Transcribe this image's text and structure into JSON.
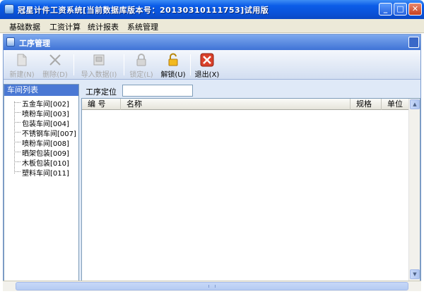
{
  "window": {
    "title": "冠星计件工资系统[当前数据库版本号：20130310111753]试用版",
    "minimize_glyph": "_",
    "maximize_glyph": "□",
    "close_glyph": "✕"
  },
  "menubar": {
    "items": [
      {
        "label": "基础数据"
      },
      {
        "label": "工资计算"
      },
      {
        "label": "统计报表"
      },
      {
        "label": "系统管理"
      }
    ]
  },
  "panel": {
    "title": "工序管理"
  },
  "toolbar": {
    "buttons": [
      {
        "label": "新建(N)",
        "icon": "new-document-icon",
        "enabled": false
      },
      {
        "label": "删除(D)",
        "icon": "delete-x-icon",
        "enabled": false
      },
      {
        "label": "导入数据(I)",
        "icon": "import-data-icon",
        "enabled": false
      },
      {
        "label": "锁定(L)",
        "icon": "lock-icon",
        "enabled": false
      },
      {
        "label": "解锁(U)",
        "icon": "unlock-icon",
        "enabled": true
      },
      {
        "label": "退出(X)",
        "icon": "exit-icon",
        "enabled": true
      }
    ]
  },
  "workshops": {
    "header": "车间列表",
    "items": [
      {
        "label": "五金车间[002]"
      },
      {
        "label": "喷粉车间[003]"
      },
      {
        "label": "包装车间[004]"
      },
      {
        "label": "不锈钢车间[007]"
      },
      {
        "label": "喷粉车间[008]"
      },
      {
        "label": "晒架包装[009]"
      },
      {
        "label": "木板包装[010]"
      },
      {
        "label": "塑料车间[011]"
      }
    ]
  },
  "locate": {
    "label": "工序定位",
    "value": ""
  },
  "grid": {
    "columns": [
      {
        "label": "编  号"
      },
      {
        "label": "名称"
      },
      {
        "label": "规格"
      },
      {
        "label": "单位"
      }
    ],
    "rows": []
  },
  "colors": {
    "title_bar": "#0a52d8",
    "menu_bg": "#ece9d8",
    "panel_bg": "#dfe9f7",
    "list_header": "#4a78d4",
    "exit_red": "#d9402a",
    "unlock_gold": "#f2b91f"
  }
}
